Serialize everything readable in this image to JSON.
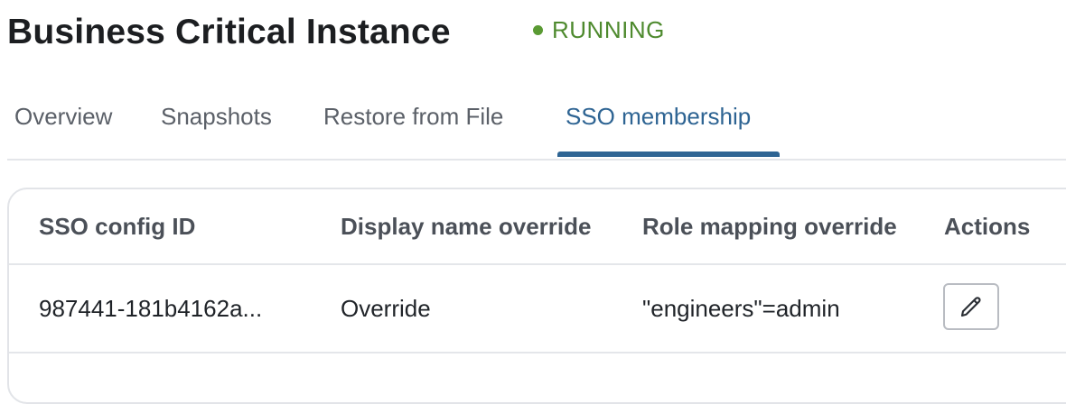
{
  "header": {
    "title": "Business Critical Instance",
    "status": "RUNNING",
    "status_color": "#5a9a33"
  },
  "tabs": [
    {
      "label": "Overview",
      "active": false
    },
    {
      "label": "Snapshots",
      "active": false
    },
    {
      "label": "Restore from File",
      "active": false
    },
    {
      "label": "SSO membership",
      "active": true
    }
  ],
  "table": {
    "columns": [
      "SSO config ID",
      "Display name override",
      "Role mapping override",
      "Actions"
    ],
    "rows": [
      {
        "sso_config_id": "987441-181b4162a...",
        "display_name_override": "Override",
        "role_mapping_override": "\"engineers\"=admin",
        "action_icon": "pencil-icon"
      }
    ]
  },
  "colors": {
    "accent": "#2e6493",
    "running": "#4e8a2e"
  }
}
